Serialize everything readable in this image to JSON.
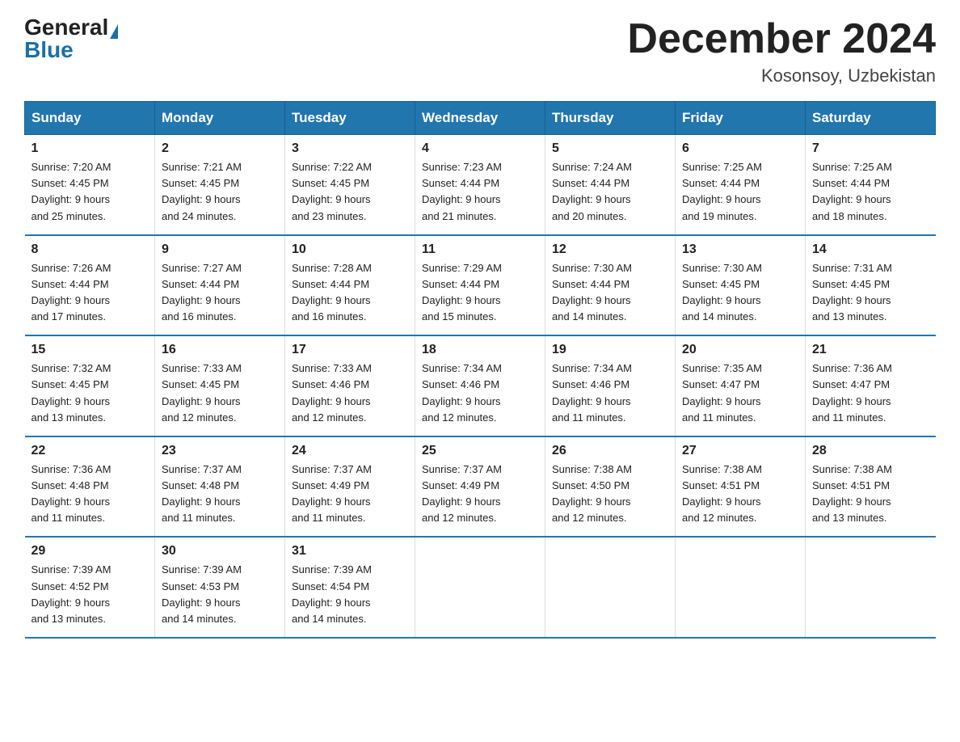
{
  "header": {
    "logo_general": "General",
    "logo_blue": "Blue",
    "month_title": "December 2024",
    "location": "Kosonsoy, Uzbekistan"
  },
  "weekdays": [
    "Sunday",
    "Monday",
    "Tuesday",
    "Wednesday",
    "Thursday",
    "Friday",
    "Saturday"
  ],
  "weeks": [
    [
      {
        "day": "1",
        "sunrise": "7:20 AM",
        "sunset": "4:45 PM",
        "daylight": "9 hours and 25 minutes."
      },
      {
        "day": "2",
        "sunrise": "7:21 AM",
        "sunset": "4:45 PM",
        "daylight": "9 hours and 24 minutes."
      },
      {
        "day": "3",
        "sunrise": "7:22 AM",
        "sunset": "4:45 PM",
        "daylight": "9 hours and 23 minutes."
      },
      {
        "day": "4",
        "sunrise": "7:23 AM",
        "sunset": "4:44 PM",
        "daylight": "9 hours and 21 minutes."
      },
      {
        "day": "5",
        "sunrise": "7:24 AM",
        "sunset": "4:44 PM",
        "daylight": "9 hours and 20 minutes."
      },
      {
        "day": "6",
        "sunrise": "7:25 AM",
        "sunset": "4:44 PM",
        "daylight": "9 hours and 19 minutes."
      },
      {
        "day": "7",
        "sunrise": "7:25 AM",
        "sunset": "4:44 PM",
        "daylight": "9 hours and 18 minutes."
      }
    ],
    [
      {
        "day": "8",
        "sunrise": "7:26 AM",
        "sunset": "4:44 PM",
        "daylight": "9 hours and 17 minutes."
      },
      {
        "day": "9",
        "sunrise": "7:27 AM",
        "sunset": "4:44 PM",
        "daylight": "9 hours and 16 minutes."
      },
      {
        "day": "10",
        "sunrise": "7:28 AM",
        "sunset": "4:44 PM",
        "daylight": "9 hours and 16 minutes."
      },
      {
        "day": "11",
        "sunrise": "7:29 AM",
        "sunset": "4:44 PM",
        "daylight": "9 hours and 15 minutes."
      },
      {
        "day": "12",
        "sunrise": "7:30 AM",
        "sunset": "4:44 PM",
        "daylight": "9 hours and 14 minutes."
      },
      {
        "day": "13",
        "sunrise": "7:30 AM",
        "sunset": "4:45 PM",
        "daylight": "9 hours and 14 minutes."
      },
      {
        "day": "14",
        "sunrise": "7:31 AM",
        "sunset": "4:45 PM",
        "daylight": "9 hours and 13 minutes."
      }
    ],
    [
      {
        "day": "15",
        "sunrise": "7:32 AM",
        "sunset": "4:45 PM",
        "daylight": "9 hours and 13 minutes."
      },
      {
        "day": "16",
        "sunrise": "7:33 AM",
        "sunset": "4:45 PM",
        "daylight": "9 hours and 12 minutes."
      },
      {
        "day": "17",
        "sunrise": "7:33 AM",
        "sunset": "4:46 PM",
        "daylight": "9 hours and 12 minutes."
      },
      {
        "day": "18",
        "sunrise": "7:34 AM",
        "sunset": "4:46 PM",
        "daylight": "9 hours and 12 minutes."
      },
      {
        "day": "19",
        "sunrise": "7:34 AM",
        "sunset": "4:46 PM",
        "daylight": "9 hours and 11 minutes."
      },
      {
        "day": "20",
        "sunrise": "7:35 AM",
        "sunset": "4:47 PM",
        "daylight": "9 hours and 11 minutes."
      },
      {
        "day": "21",
        "sunrise": "7:36 AM",
        "sunset": "4:47 PM",
        "daylight": "9 hours and 11 minutes."
      }
    ],
    [
      {
        "day": "22",
        "sunrise": "7:36 AM",
        "sunset": "4:48 PM",
        "daylight": "9 hours and 11 minutes."
      },
      {
        "day": "23",
        "sunrise": "7:37 AM",
        "sunset": "4:48 PM",
        "daylight": "9 hours and 11 minutes."
      },
      {
        "day": "24",
        "sunrise": "7:37 AM",
        "sunset": "4:49 PM",
        "daylight": "9 hours and 11 minutes."
      },
      {
        "day": "25",
        "sunrise": "7:37 AM",
        "sunset": "4:49 PM",
        "daylight": "9 hours and 12 minutes."
      },
      {
        "day": "26",
        "sunrise": "7:38 AM",
        "sunset": "4:50 PM",
        "daylight": "9 hours and 12 minutes."
      },
      {
        "day": "27",
        "sunrise": "7:38 AM",
        "sunset": "4:51 PM",
        "daylight": "9 hours and 12 minutes."
      },
      {
        "day": "28",
        "sunrise": "7:38 AM",
        "sunset": "4:51 PM",
        "daylight": "9 hours and 13 minutes."
      }
    ],
    [
      {
        "day": "29",
        "sunrise": "7:39 AM",
        "sunset": "4:52 PM",
        "daylight": "9 hours and 13 minutes."
      },
      {
        "day": "30",
        "sunrise": "7:39 AM",
        "sunset": "4:53 PM",
        "daylight": "9 hours and 14 minutes."
      },
      {
        "day": "31",
        "sunrise": "7:39 AM",
        "sunset": "4:54 PM",
        "daylight": "9 hours and 14 minutes."
      },
      null,
      null,
      null,
      null
    ]
  ],
  "labels": {
    "sunrise": "Sunrise:",
    "sunset": "Sunset:",
    "daylight": "Daylight:"
  }
}
